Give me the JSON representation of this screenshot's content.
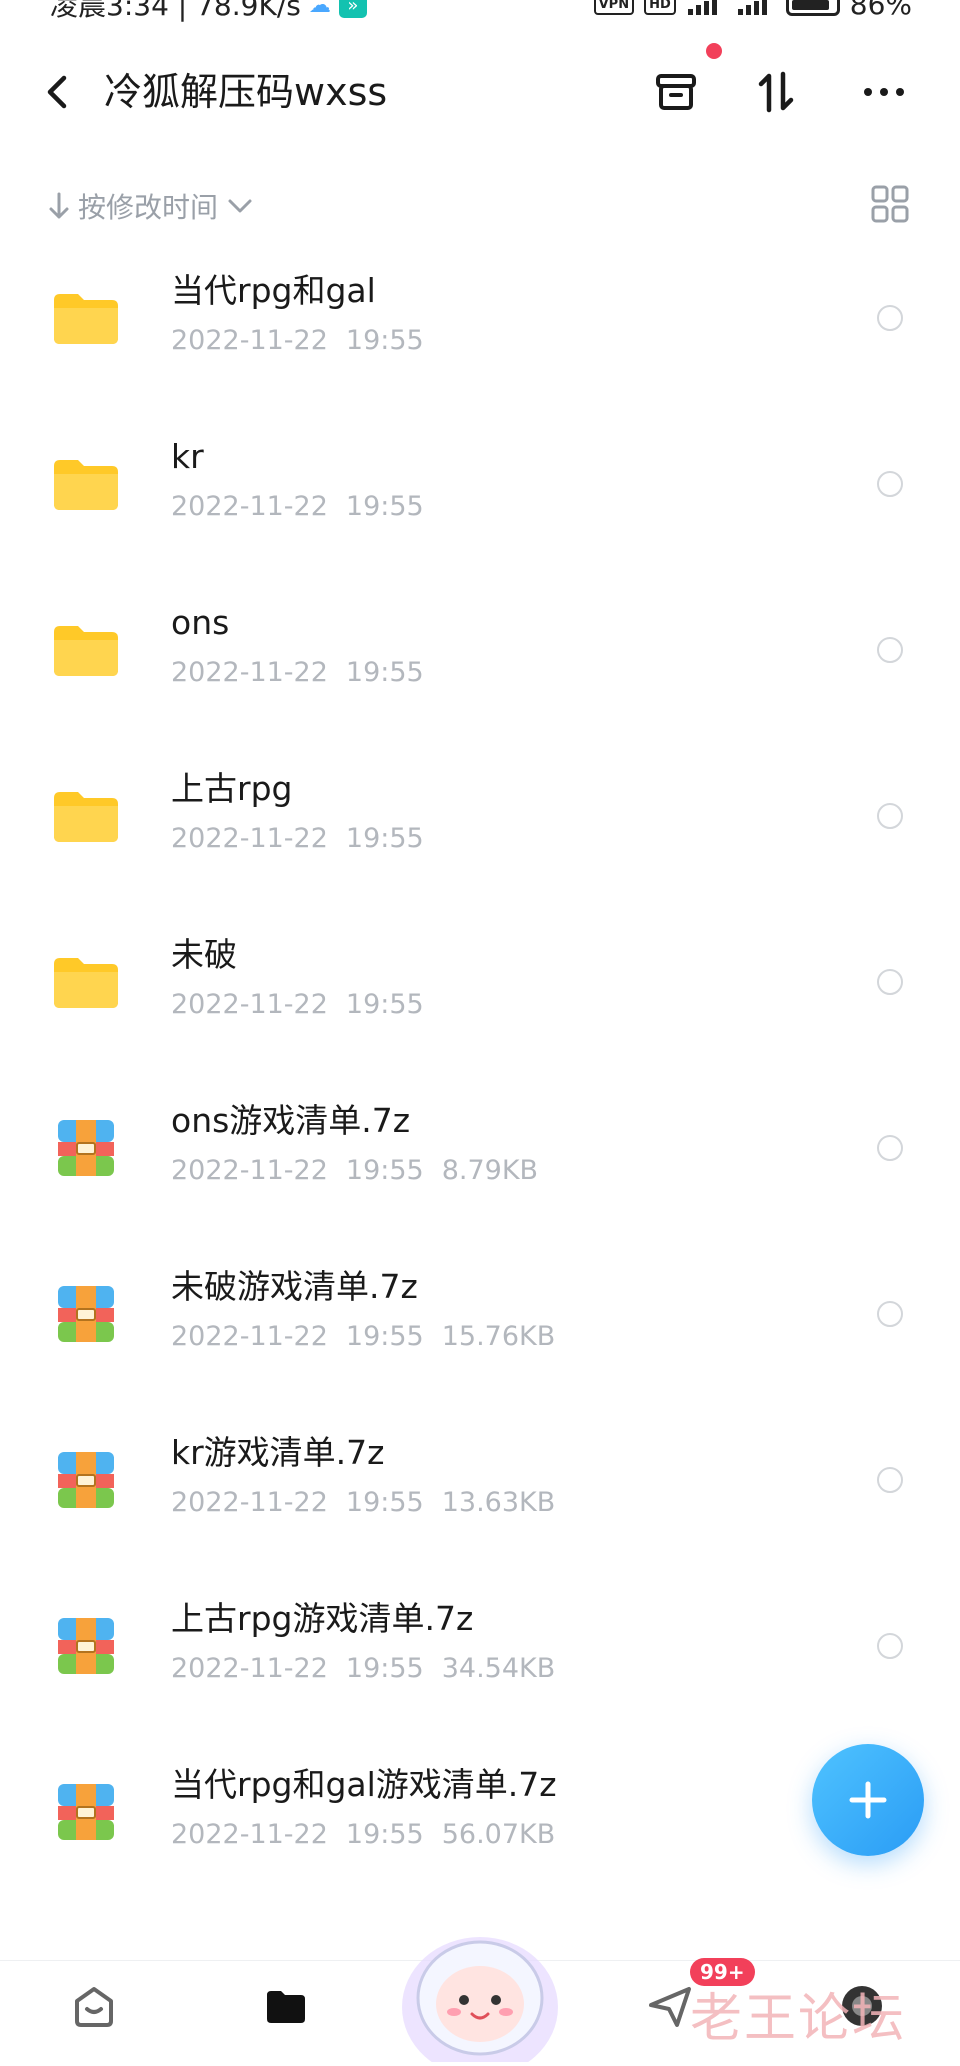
{
  "status_bar": {
    "time_text": "凌晨3:34 | 78.9K/s",
    "vpn": "VPN",
    "hd": "HD",
    "battery": "86%"
  },
  "header": {
    "title": "冷狐解压码wxss"
  },
  "sort": {
    "label": "按修改时间"
  },
  "colors": {
    "accent": "#2a9cf5",
    "folder": "#ffc928",
    "badge": "#f2405a"
  },
  "files": [
    {
      "name": "当代rpg和gal",
      "date": "2022-11-22",
      "time": "19:55",
      "size": "",
      "type": "folder"
    },
    {
      "name": "kr",
      "date": "2022-11-22",
      "time": "19:55",
      "size": "",
      "type": "folder"
    },
    {
      "name": "ons",
      "date": "2022-11-22",
      "time": "19:55",
      "size": "",
      "type": "folder"
    },
    {
      "name": "上古rpg",
      "date": "2022-11-22",
      "time": "19:55",
      "size": "",
      "type": "folder"
    },
    {
      "name": "未破",
      "date": "2022-11-22",
      "time": "19:55",
      "size": "",
      "type": "folder"
    },
    {
      "name": "ons游戏清单.7z",
      "date": "2022-11-22",
      "time": "19:55",
      "size": "8.79KB",
      "type": "archive"
    },
    {
      "name": "未破游戏清单.7z",
      "date": "2022-11-22",
      "time": "19:55",
      "size": "15.76KB",
      "type": "archive"
    },
    {
      "name": "kr游戏清单.7z",
      "date": "2022-11-22",
      "time": "19:55",
      "size": "13.63KB",
      "type": "archive"
    },
    {
      "name": "上古rpg游戏清单.7z",
      "date": "2022-11-22",
      "time": "19:55",
      "size": "34.54KB",
      "type": "archive"
    },
    {
      "name": "当代rpg和gal游戏清单.7z",
      "date": "2022-11-22",
      "time": "19:55",
      "size": "56.07KB",
      "type": "archive"
    }
  ],
  "bottom_nav": {
    "badge": "99+",
    "watermark": "老王论坛"
  }
}
